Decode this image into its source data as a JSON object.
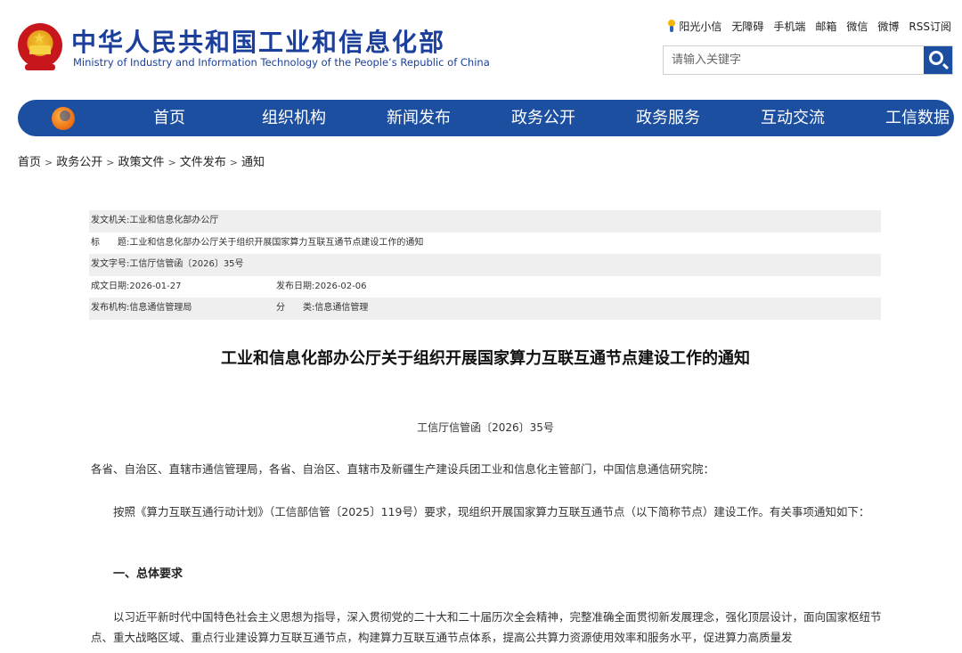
{
  "header": {
    "site_title": "中华人民共和国工业和信息化部",
    "site_subtitle": "Ministry of Industry and Information Technology of the People’s Republic of China",
    "top_links": [
      "阳光小信",
      "无障碍",
      "手机端",
      "邮箱",
      "微信",
      "微博",
      "RSS订阅"
    ],
    "search_placeholder": "请输入关键字"
  },
  "nav": {
    "items": [
      "首页",
      "组织机构",
      "新闻发布",
      "政务公开",
      "政务服务",
      "互动交流",
      "工信数据"
    ]
  },
  "breadcrumb": [
    "首页",
    "政务公开",
    "政策文件",
    "文件发布",
    "通知"
  ],
  "meta": {
    "issuer_label": "发文机关:",
    "issuer": "工业和信息化部办公厅",
    "title_label": "标　　题:",
    "title": "工业和信息化部办公厅关于组织开展国家算力互联互通节点建设工作的通知",
    "doc_no_label": "发文字号:",
    "doc_no": "工信厅信管函〔2026〕35号",
    "written_date_label": "成文日期:",
    "written_date": "2026-01-27",
    "publish_date_label": "发布日期:",
    "publish_date": "2026-02-06",
    "publisher_label": "发布机构:",
    "publisher": "信息通信管理局",
    "category_label": "分　　类:",
    "category": "信息通信管理"
  },
  "article": {
    "title": "工业和信息化部办公厅关于组织开展国家算力互联互通节点建设工作的通知",
    "doc_number": "工信厅信管函〔2026〕35号",
    "recipients": "各省、自治区、直辖市通信管理局，各省、自治区、直辖市及新疆生产建设兵团工业和信息化主管部门，中国信息通信研究院：",
    "intro": "按照《算力互联互通行动计划》（工信部信管〔2025〕119号）要求，现组织开展国家算力互联互通节点（以下简称节点）建设工作。有关事项通知如下：",
    "section1_heading": "一、总体要求",
    "section1_body": "以习近平新时代中国特色社会主义思想为指导，深入贯彻党的二十大和二十届历次全会精神，完整准确全面贯彻新发展理念，强化顶层设计，面向国家枢纽节点、重大战略区域、重点行业建设算力互联互通节点，构建算力互联互通节点体系，提高公共算力资源使用效率和服务水平，促进算力高质量发"
  },
  "colors": {
    "brand_blue": "#1d4fa0",
    "title_blue": "#1b3f9a",
    "meta_shade": "#efefef"
  }
}
